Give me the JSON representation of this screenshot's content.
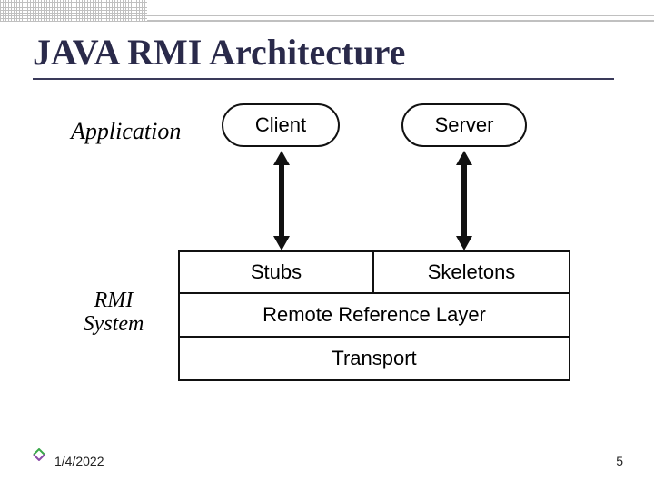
{
  "title": "JAVA RMI Architecture",
  "labels": {
    "application": "Application",
    "rmi_system_line1": "RMI",
    "rmi_system_line2": "System"
  },
  "nodes": {
    "client": "Client",
    "server": "Server",
    "stubs": "Stubs",
    "skeletons": "Skeletons",
    "rrl": "Remote Reference Layer",
    "transport": "Transport"
  },
  "footer": {
    "date": "1/4/2022",
    "page": "5"
  }
}
